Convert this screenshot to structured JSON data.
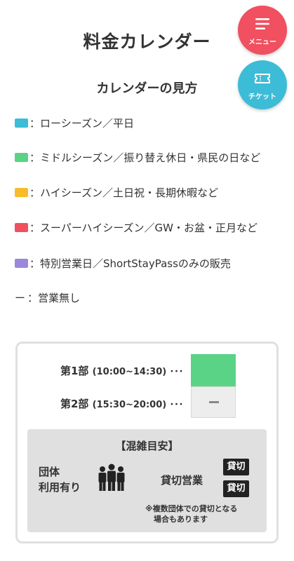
{
  "header": {
    "title": "料金カレンダー",
    "subtitle": "カレンダーの見方"
  },
  "fab": {
    "menu_label": "メニュー",
    "ticket_label": "チケット",
    "menu_color": "#f0505f",
    "ticket_color": "#3cbcd6",
    "menu_icon": "hamburger-icon",
    "ticket_icon": "ticket-icon"
  },
  "legend": [
    {
      "color": "#3cbcd6",
      "label": "：ローシーズン／平日"
    },
    {
      "color": "#5ad387",
      "label": "：ミドルシーズン／振り替え休日・県民の日など"
    },
    {
      "color": "#f8bb2c",
      "label": "：ハイシーズン／土日祝・長期休暇など"
    },
    {
      "color": "#f0505f",
      "label": "：スーパーハイシーズン／GW・お盆・正月など"
    },
    {
      "color": "#9a88dd",
      "label": "：特別営業日／ShortStayPassのみの販売"
    }
  ],
  "legend_none": {
    "dash": "ー",
    "label": "：営業無し"
  },
  "example": {
    "part1_label": "第1部",
    "part1_time": "(10:00~14:30) ･･･",
    "part2_label": "第2部",
    "part2_time": "(15:30~20:00) ･･･",
    "part1_color": "#5ad387"
  },
  "congestion": {
    "title": "【混雑目安】",
    "group_line1": "団体",
    "group_line2": "利用有り",
    "group_icon": "group-people-icon",
    "charter_label": "貸切営業",
    "charter_badge_1": "貸切",
    "charter_badge_2": "貸切",
    "note_line1": "※複数団体での貸切となる",
    "note_line2": "場合もあります"
  }
}
